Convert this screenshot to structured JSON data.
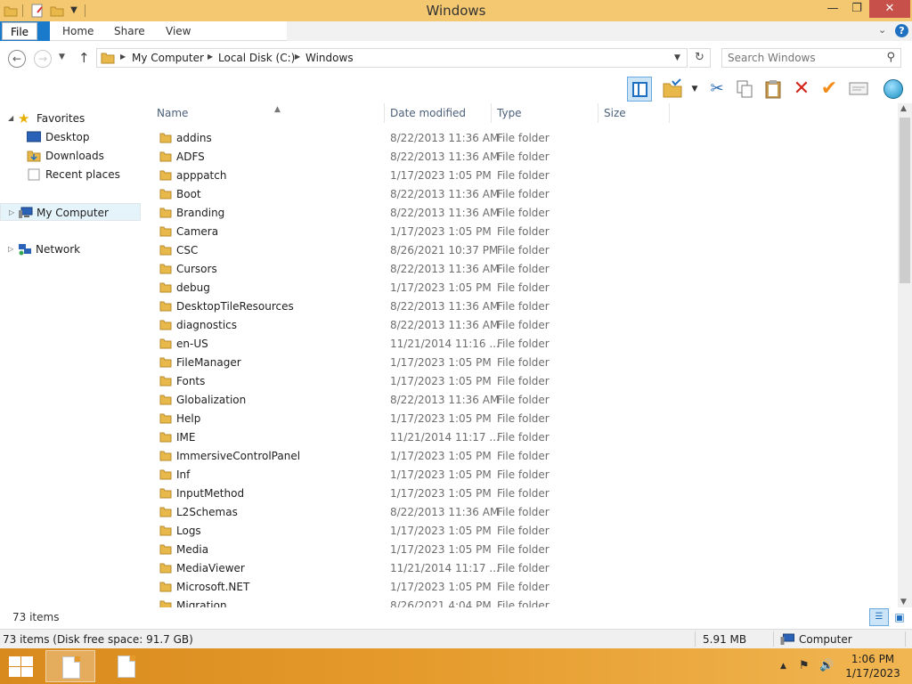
{
  "window": {
    "title": "Windows"
  },
  "ribbon": {
    "tabs": {
      "file": "File",
      "home": "Home",
      "share": "Share",
      "view": "View"
    },
    "help": "?"
  },
  "address": {
    "crumbs": [
      "My Computer",
      "Local Disk (C:)",
      "Windows"
    ]
  },
  "search": {
    "placeholder": "Search Windows"
  },
  "nav": {
    "favorites": "Favorites",
    "desktop": "Desktop",
    "downloads": "Downloads",
    "recent": "Recent places",
    "mycomputer": "My Computer",
    "network": "Network"
  },
  "columns": {
    "name": "Name",
    "date": "Date modified",
    "type": "Type",
    "size": "Size"
  },
  "files": [
    {
      "name": "addins",
      "date": "8/22/2013 11:36 AM",
      "type": "File folder"
    },
    {
      "name": "ADFS",
      "date": "8/22/2013 11:36 AM",
      "type": "File folder"
    },
    {
      "name": "apppatch",
      "date": "1/17/2023 1:05 PM",
      "type": "File folder"
    },
    {
      "name": "Boot",
      "date": "8/22/2013 11:36 AM",
      "type": "File folder"
    },
    {
      "name": "Branding",
      "date": "8/22/2013 11:36 AM",
      "type": "File folder"
    },
    {
      "name": "Camera",
      "date": "1/17/2023 1:05 PM",
      "type": "File folder"
    },
    {
      "name": "CSC",
      "date": "8/26/2021 10:37 PM",
      "type": "File folder"
    },
    {
      "name": "Cursors",
      "date": "8/22/2013 11:36 AM",
      "type": "File folder"
    },
    {
      "name": "debug",
      "date": "1/17/2023 1:05 PM",
      "type": "File folder"
    },
    {
      "name": "DesktopTileResources",
      "date": "8/22/2013 11:36 AM",
      "type": "File folder"
    },
    {
      "name": "diagnostics",
      "date": "8/22/2013 11:36 AM",
      "type": "File folder"
    },
    {
      "name": "en-US",
      "date": "11/21/2014 11:16 ...",
      "type": "File folder"
    },
    {
      "name": "FileManager",
      "date": "1/17/2023 1:05 PM",
      "type": "File folder"
    },
    {
      "name": "Fonts",
      "date": "1/17/2023 1:05 PM",
      "type": "File folder"
    },
    {
      "name": "Globalization",
      "date": "8/22/2013 11:36 AM",
      "type": "File folder"
    },
    {
      "name": "Help",
      "date": "1/17/2023 1:05 PM",
      "type": "File folder"
    },
    {
      "name": "IME",
      "date": "11/21/2014 11:17 ...",
      "type": "File folder"
    },
    {
      "name": "ImmersiveControlPanel",
      "date": "1/17/2023 1:05 PM",
      "type": "File folder"
    },
    {
      "name": "Inf",
      "date": "1/17/2023 1:05 PM",
      "type": "File folder"
    },
    {
      "name": "InputMethod",
      "date": "1/17/2023 1:05 PM",
      "type": "File folder"
    },
    {
      "name": "L2Schemas",
      "date": "8/22/2013 11:36 AM",
      "type": "File folder"
    },
    {
      "name": "Logs",
      "date": "1/17/2023 1:05 PM",
      "type": "File folder"
    },
    {
      "name": "Media",
      "date": "1/17/2023 1:05 PM",
      "type": "File folder"
    },
    {
      "name": "MediaViewer",
      "date": "11/21/2014 11:17 ...",
      "type": "File folder"
    },
    {
      "name": "Microsoft.NET",
      "date": "1/17/2023 1:05 PM",
      "type": "File folder"
    },
    {
      "name": "Migration",
      "date": "8/26/2021 4:04 PM",
      "type": "File folder"
    }
  ],
  "status": {
    "item_count": "73 items",
    "disk_info": "73 items (Disk free space: 91.7 GB)",
    "size": "5.91 MB",
    "location": "Computer"
  },
  "taskbar": {
    "time": "1:06 PM",
    "date": "1/17/2023"
  },
  "colors": {
    "titlebar": "#f3c870",
    "accent": "#1979ca",
    "taskbar": "#e59a2b",
    "folder": "#e8b94a"
  },
  "icons": {
    "folder": "folder-icon",
    "back": "back-arrow-icon",
    "forward": "forward-arrow-icon",
    "up": "up-arrow-icon",
    "refresh": "refresh-icon",
    "search": "search-icon",
    "cut": "scissors-icon",
    "copy": "copy-icon",
    "paste": "clipboard-icon",
    "delete": "red-x-icon",
    "rename": "checkmark-icon",
    "properties": "properties-icon",
    "globe": "globe-icon",
    "star": "star-icon",
    "computer": "computer-icon",
    "network": "network-icon"
  }
}
